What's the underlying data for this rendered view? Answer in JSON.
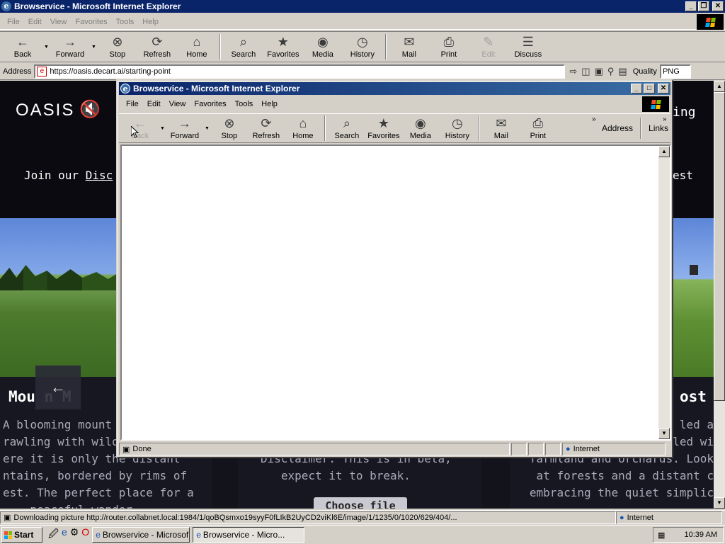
{
  "main_window": {
    "title": "Browservice - Microsoft Internet Explorer",
    "controls": [
      "_",
      "❐",
      "✕"
    ],
    "menu": [
      "File",
      "Edit",
      "View",
      "Favorites",
      "Tools",
      "Help"
    ],
    "toolbar": [
      {
        "label": "Back",
        "icon": "←"
      },
      {
        "label": "Forward",
        "icon": "→"
      },
      {
        "label": "Stop",
        "icon": "⊗"
      },
      {
        "label": "Refresh",
        "icon": "⟳"
      },
      {
        "label": "Home",
        "icon": "⌂"
      },
      {
        "label": "Search",
        "icon": "⌕"
      },
      {
        "label": "Favorites",
        "icon": "★"
      },
      {
        "label": "Media",
        "icon": "◉"
      },
      {
        "label": "History",
        "icon": "◷"
      },
      {
        "label": "Mail",
        "icon": "✉"
      },
      {
        "label": "Print",
        "icon": "⎙"
      },
      {
        "label": "Edit",
        "icon": "✎"
      },
      {
        "label": "Discuss",
        "icon": "☰"
      }
    ],
    "address_label": "Address",
    "url": "https://oasis.decart.ai/starting-point",
    "quality_label": "Quality",
    "quality_value": "PNG",
    "status_text": "Downloading picture http://router.collabnet.local:1984/1/qoBQsmxo19syyF0fLIkB2UyCD2viKl6E/image/1/1235/0/1020/629/404/...",
    "status_zone": "Internet"
  },
  "site": {
    "logo": "OASIS",
    "join_prefix": "Join our ",
    "join_link": "Disc",
    "right_top": "ing",
    "right_mid": "est",
    "left_card_title": "Mou   n M",
    "right_card_title": "ost",
    "left_desc": "A blooming mount\nrawling with wilo\nere it is only the distant\nntains, bordered by rims of\nest. The perfect place for a\n    peaceful wander",
    "center_desc": "Disclaimer: This is in beta,\n   expect it to break.",
    "right_desc": "led a\nled wi\nfarmland and orchards. Look\n at forests and a distant c\nembracing the quiet simplic",
    "choose_btn": "Choose file",
    "arrow": "←"
  },
  "popup": {
    "title": "Browservice - Microsoft Internet Explorer",
    "controls": [
      "_",
      "□",
      "✕"
    ],
    "menu": [
      "File",
      "Edit",
      "View",
      "Favorites",
      "Tools",
      "Help"
    ],
    "toolbar": [
      {
        "label": "Back",
        "icon": "←"
      },
      {
        "label": "Forward",
        "icon": "→"
      },
      {
        "label": "Stop",
        "icon": "⊗"
      },
      {
        "label": "Refresh",
        "icon": "⟳"
      },
      {
        "label": "Home",
        "icon": "⌂"
      },
      {
        "label": "Search",
        "icon": "⌕"
      },
      {
        "label": "Favorites",
        "icon": "★"
      },
      {
        "label": "Media",
        "icon": "◉"
      },
      {
        "label": "History",
        "icon": "◷"
      },
      {
        "label": "Mail",
        "icon": "✉"
      },
      {
        "label": "Print",
        "icon": "⎙"
      }
    ],
    "address_label": "Address",
    "links_label": "Links",
    "status_text": "Done",
    "status_zone": "Internet"
  },
  "taskbar": {
    "start": "Start",
    "tasks": [
      "Browservice - Microsof...",
      "Browservice - Micro..."
    ],
    "clock": "10:39 AM"
  },
  "colors": {
    "title_active": "#0a246a",
    "title_gradient_end": "#3a6ea5",
    "chrome": "#d4d0c8",
    "site_bg": "#13131c"
  }
}
